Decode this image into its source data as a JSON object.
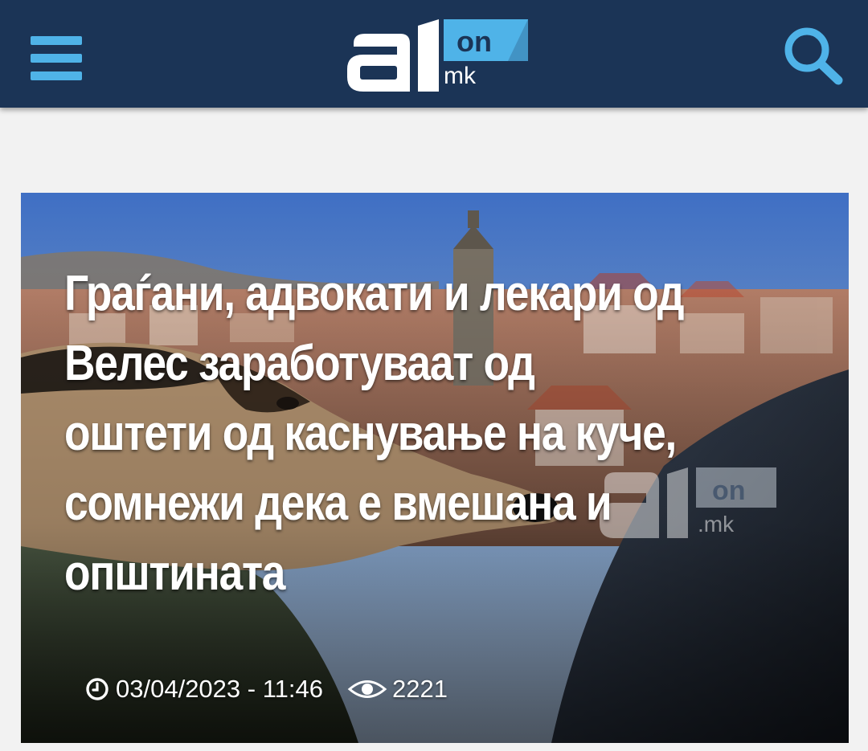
{
  "header": {
    "logo": {
      "primary": "a1",
      "badge": "on",
      "domain": "mk"
    },
    "menu_icon": "hamburger-menu-icon",
    "search_icon": "magnifier-search-icon",
    "background": "#1b3456",
    "accent": "#4fb3e8"
  },
  "article": {
    "headline": "Граѓани, адвокати и лекари од Велес заработуваат од оштети од каснување на куче, сомнежи дека е вмешана и општината",
    "date": "03/04/2023 - 11:46",
    "views": "2221",
    "watermark": {
      "primary": "a1",
      "badge": "on",
      "domain": ".mk"
    }
  }
}
